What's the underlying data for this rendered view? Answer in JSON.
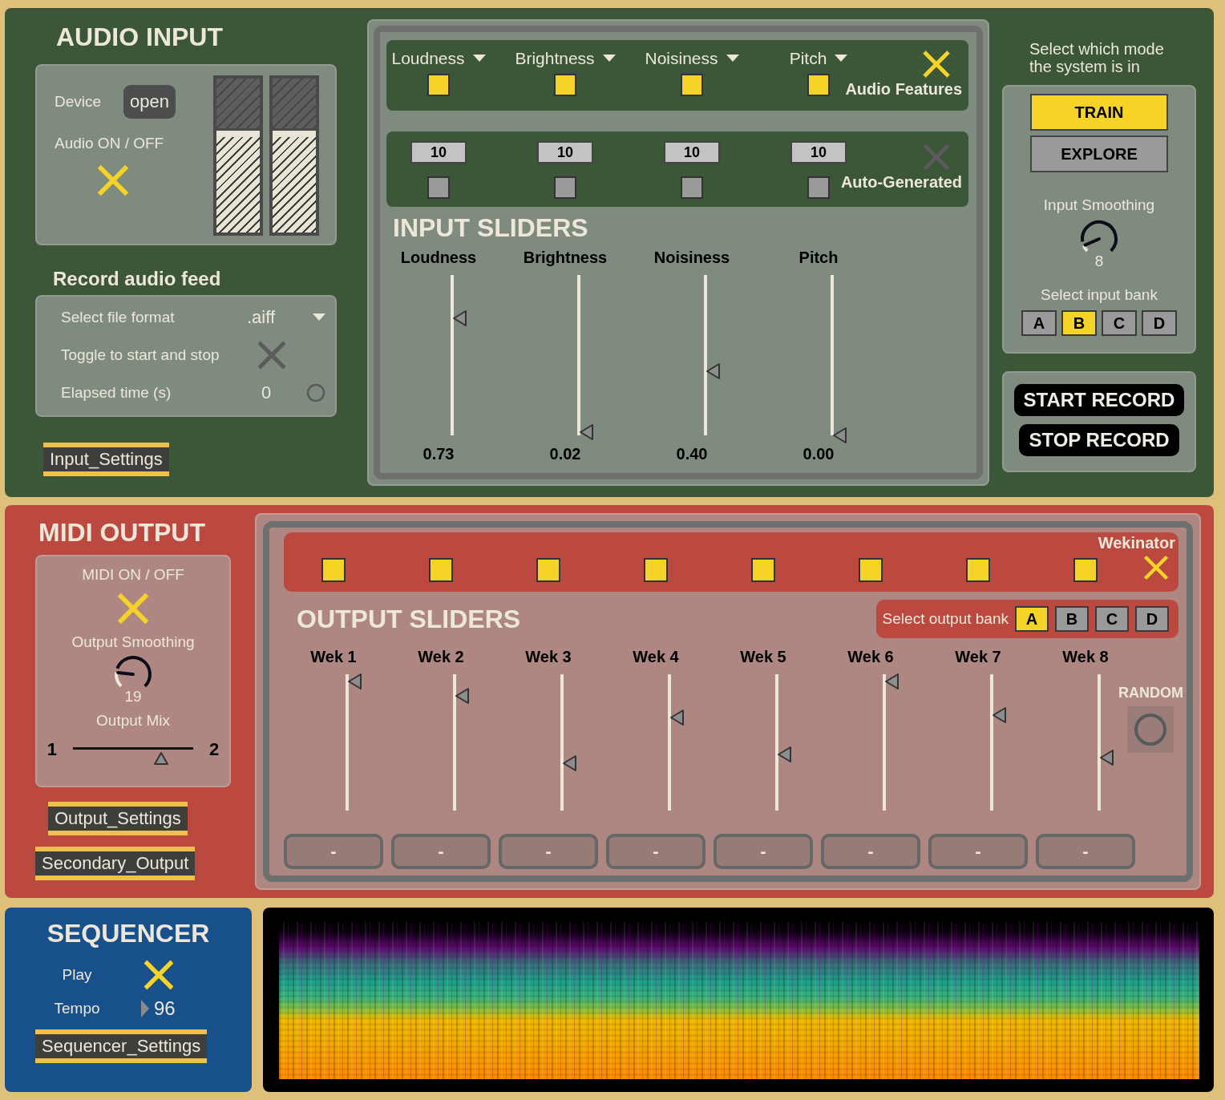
{
  "audio_input": {
    "title": "AUDIO INPUT",
    "device_label": "Device",
    "device_button": "open",
    "audio_label": "Audio ON / OFF",
    "audio_on": true,
    "meters": [
      {
        "level": 0.66
      },
      {
        "level": 0.66
      }
    ],
    "record_title": "Record audio feed",
    "format_label": "Select file format",
    "format": ".aiff",
    "record_toggle_label": "Toggle to start and stop",
    "recording": false,
    "elapsed_label": "Elapsed time (s)",
    "elapsed": "0",
    "settings_button": "Input_Settings"
  },
  "features": {
    "items": [
      {
        "label": "Loudness",
        "enabled": true,
        "number": "10",
        "auto": false
      },
      {
        "label": "Brightness",
        "enabled": true,
        "number": "10",
        "auto": false
      },
      {
        "label": "Noisiness",
        "enabled": true,
        "number": "10",
        "auto": false
      },
      {
        "label": "Pitch",
        "enabled": true,
        "number": "10",
        "auto": false
      }
    ],
    "features_on": true,
    "features_label": "Audio Features",
    "auto_on": false,
    "auto_label": "Auto-Generated"
  },
  "input_sliders": {
    "title": "INPUT SLIDERS",
    "sliders": [
      {
        "label": "Loudness",
        "level": 0.73,
        "reading": "0.73"
      },
      {
        "label": "Brightness",
        "level": 0.02,
        "reading": "0.02"
      },
      {
        "label": "Noisiness",
        "level": 0.4,
        "reading": "0.40"
      },
      {
        "label": "Pitch",
        "level": 0.0,
        "reading": "0.00"
      }
    ]
  },
  "mode_panel": {
    "prompt": "Select which mode the system is in",
    "modes": [
      {
        "label": "TRAIN",
        "selected": true
      },
      {
        "label": "EXPLORE",
        "selected": false
      }
    ],
    "smoothing_label": "Input Smoothing",
    "smoothing": {
      "level": 0.08,
      "reading": "8"
    },
    "bank_label": "Select input bank",
    "banks": [
      {
        "label": "A",
        "selected": false
      },
      {
        "label": "B",
        "selected": true
      },
      {
        "label": "C",
        "selected": false
      },
      {
        "label": "D",
        "selected": false
      }
    ]
  },
  "record_buttons": [
    "START RECORD",
    "STOP RECORD"
  ],
  "midi_output": {
    "title": "MIDI OUTPUT",
    "toggle_label": "MIDI ON / OFF",
    "midi_on": true,
    "smoothing_label": "Output Smoothing",
    "smoothing": {
      "level": 0.19,
      "reading": "19"
    },
    "mix_label": "Output Mix",
    "mix_min": "1",
    "mix_max": "2",
    "mix": {
      "level": 0.73
    },
    "buttons": [
      "Output_Settings",
      "Secondary_Output"
    ]
  },
  "output_sliders": {
    "wekinator_label": "Wekinator",
    "wekinator_on": true,
    "title": "OUTPUT SLIDERS",
    "bank_label": "Select output bank",
    "banks": [
      {
        "label": "A",
        "selected": true
      },
      {
        "label": "B",
        "selected": false
      },
      {
        "label": "C",
        "selected": false
      },
      {
        "label": "D",
        "selected": false
      }
    ],
    "channels": [
      {
        "label": "Wek 1",
        "enabled": true,
        "level": 0.95,
        "button": "-"
      },
      {
        "label": "Wek 2",
        "enabled": true,
        "level": 0.84,
        "button": "-"
      },
      {
        "label": "Wek 3",
        "enabled": true,
        "level": 0.35,
        "button": "-"
      },
      {
        "label": "Wek 4",
        "enabled": true,
        "level": 0.68,
        "button": "-"
      },
      {
        "label": "Wek 5",
        "enabled": true,
        "level": 0.41,
        "button": "-"
      },
      {
        "label": "Wek 6",
        "enabled": true,
        "level": 0.95,
        "button": "-"
      },
      {
        "label": "Wek 7",
        "enabled": true,
        "level": 0.7,
        "button": "-"
      },
      {
        "label": "Wek 8",
        "enabled": true,
        "level": 0.39,
        "button": "-"
      }
    ],
    "random_label": "RANDOM"
  },
  "sequencer": {
    "title": "SEQUENCER",
    "play_label": "Play",
    "playing": true,
    "tempo_label": "Tempo",
    "tempo": "96",
    "settings_button": "Sequencer_Settings"
  }
}
